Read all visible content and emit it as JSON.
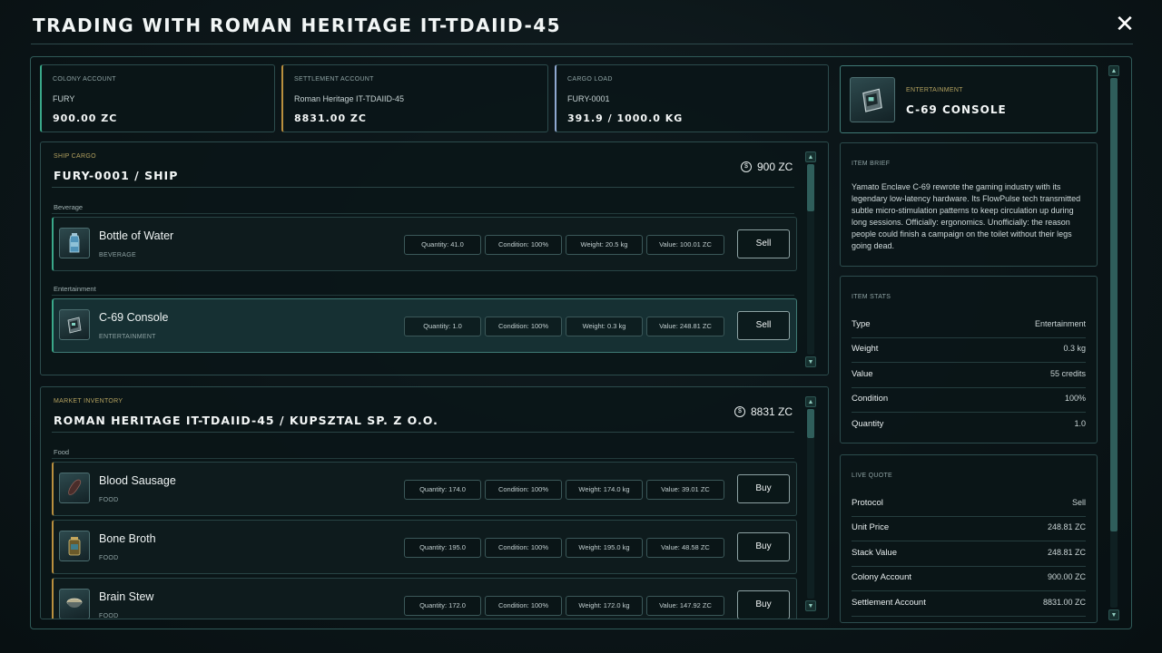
{
  "window": {
    "title": "TRADING WITH ROMAN HERITAGE IT-TDAIID-45",
    "close_icon": "close-icon"
  },
  "accounts": [
    {
      "label": "COLONY ACCOUNT",
      "name": "FURY",
      "value": "900.00 ZC",
      "accent": "#3aa889"
    },
    {
      "label": "SETTLEMENT ACCOUNT",
      "name": "Roman Heritage IT-TDAIID-45",
      "value": "8831.00 ZC",
      "accent": "#b98f3e"
    },
    {
      "label": "CARGO LOAD",
      "name": "FURY-0001",
      "value": "391.9 / 1000.0 KG",
      "accent": "#8fa8d0"
    }
  ],
  "ship_cargo": {
    "label": "SHIP CARGO",
    "title": "FURY-0001 / SHIP",
    "money": "900 ZC",
    "groups": [
      {
        "category": "Beverage",
        "items": [
          {
            "name": "Bottle of Water",
            "category": "BEVERAGE",
            "quantity": "Quantity: 41.0",
            "condition": "Condition: 100%",
            "weight": "Weight: 20.5 kg",
            "value": "Value: 100.01 ZC",
            "action": "Sell",
            "icon": "water-bottle-icon"
          }
        ]
      },
      {
        "category": "Entertainment",
        "items": [
          {
            "name": "C-69 Console",
            "category": "ENTERTAINMENT",
            "quantity": "Quantity: 1.0",
            "condition": "Condition: 100%",
            "weight": "Weight: 0.3 kg",
            "value": "Value: 248.81 ZC",
            "action": "Sell",
            "icon": "console-icon"
          }
        ]
      }
    ],
    "scroll_fraction": 0.0
  },
  "market": {
    "label": "MARKET INVENTORY",
    "title": "ROMAN HERITAGE IT-TDAIID-45 / KUPSZTAL SP. Z O.O.",
    "money": "8831 ZC",
    "groups": [
      {
        "category": "Food",
        "items": [
          {
            "name": "Blood Sausage",
            "category": "FOOD",
            "quantity": "Quantity: 174.0",
            "condition": "Condition: 100%",
            "weight": "Weight: 174.0 kg",
            "value": "Value: 39.01 ZC",
            "action": "Buy",
            "icon": "sausage-icon"
          },
          {
            "name": "Bone Broth",
            "category": "FOOD",
            "quantity": "Quantity: 195.0",
            "condition": "Condition: 100%",
            "weight": "Weight: 195.0 kg",
            "value": "Value: 48.58 ZC",
            "action": "Buy",
            "icon": "broth-jar-icon"
          },
          {
            "name": "Brain Stew",
            "category": "FOOD",
            "quantity": "Quantity: 172.0",
            "condition": "Condition: 100%",
            "weight": "Weight: 172.0 kg",
            "value": "Value: 147.92 ZC",
            "action": "Buy",
            "icon": "stew-bowl-icon"
          }
        ]
      }
    ]
  },
  "selected_item": {
    "category": "ENTERTAINMENT",
    "name": "C-69 CONSOLE",
    "icon": "console-icon"
  },
  "item_brief": {
    "label": "ITEM BRIEF",
    "text": "Yamato Enclave C-69 rewrote the gaming industry with its legendary low-latency hardware. Its FlowPulse tech transmitted subtle micro-stimulation patterns to keep circulation up during long sessions. Officially: ergonomics. Unofficially: the reason people could finish a campaign on the toilet without their legs going dead."
  },
  "item_stats": {
    "label": "ITEM STATS",
    "rows": [
      {
        "key": "Type",
        "value": "Entertainment"
      },
      {
        "key": "Weight",
        "value": "0.3 kg"
      },
      {
        "key": "Value",
        "value": "55 credits"
      },
      {
        "key": "Condition",
        "value": "100%"
      },
      {
        "key": "Quantity",
        "value": "1.0"
      }
    ]
  },
  "live_quote": {
    "label": "LIVE QUOTE",
    "rows": [
      {
        "key": "Protocol",
        "value": "Sell"
      },
      {
        "key": "Unit Price",
        "value": "248.81 ZC"
      },
      {
        "key": "Stack Value",
        "value": "248.81 ZC"
      },
      {
        "key": "Colony Account",
        "value": "900.00 ZC"
      },
      {
        "key": "Settlement Account",
        "value": "8831.00 ZC"
      }
    ]
  }
}
